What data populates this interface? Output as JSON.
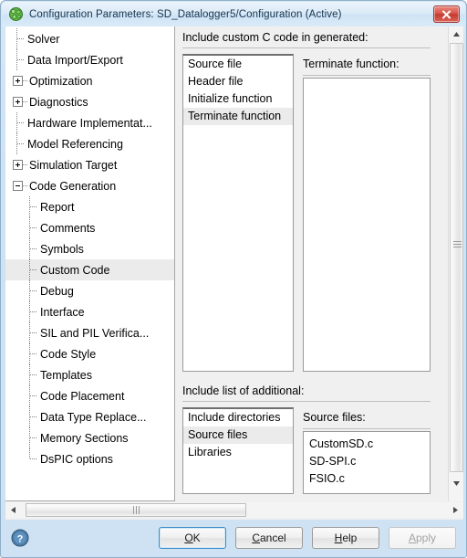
{
  "window": {
    "title": "Configuration Parameters: SD_Datalogger5/Configuration (Active)",
    "app_icon_name": "simulink-icon",
    "close_label": "x",
    "frame_color": "#cfe2f3",
    "titlebar_color": "#dcebf8",
    "close_button_color": "#c33a2f"
  },
  "sidebar": {
    "items": [
      {
        "label": "Solver",
        "depth": 1,
        "toggle": "none"
      },
      {
        "label": "Data Import/Export",
        "depth": 1,
        "toggle": "none"
      },
      {
        "label": "Optimization",
        "depth": 1,
        "toggle": "plus"
      },
      {
        "label": "Diagnostics",
        "depth": 1,
        "toggle": "plus"
      },
      {
        "label": "Hardware Implementat...",
        "depth": 1,
        "toggle": "none"
      },
      {
        "label": "Model Referencing",
        "depth": 1,
        "toggle": "none"
      },
      {
        "label": "Simulation Target",
        "depth": 1,
        "toggle": "plus"
      },
      {
        "label": "Code Generation",
        "depth": 1,
        "toggle": "minus"
      },
      {
        "label": "Report",
        "depth": 2,
        "toggle": "none"
      },
      {
        "label": "Comments",
        "depth": 2,
        "toggle": "none"
      },
      {
        "label": "Symbols",
        "depth": 2,
        "toggle": "none"
      },
      {
        "label": "Custom Code",
        "depth": 2,
        "toggle": "none",
        "selected": true
      },
      {
        "label": "Debug",
        "depth": 2,
        "toggle": "none"
      },
      {
        "label": "Interface",
        "depth": 2,
        "toggle": "none"
      },
      {
        "label": "SIL and PIL Verifica...",
        "depth": 2,
        "toggle": "none"
      },
      {
        "label": "Code Style",
        "depth": 2,
        "toggle": "none"
      },
      {
        "label": "Templates",
        "depth": 2,
        "toggle": "none"
      },
      {
        "label": "Code Placement",
        "depth": 2,
        "toggle": "none"
      },
      {
        "label": "Data Type Replace...",
        "depth": 2,
        "toggle": "none"
      },
      {
        "label": "Memory Sections",
        "depth": 2,
        "toggle": "none"
      },
      {
        "label": "DsPIC options",
        "depth": 2,
        "toggle": "none",
        "last": true
      }
    ],
    "selected_item": "Custom Code"
  },
  "main": {
    "custom_code": {
      "group_label": "Include custom C code in generated:",
      "list_items": [
        "Source file",
        "Header file",
        "Initialize function",
        "Terminate function"
      ],
      "selected_item": "Terminate function",
      "editor_label": "Terminate function:",
      "editor_value": ""
    },
    "additional": {
      "group_label": "Include list of additional:",
      "list_items": [
        "Include directories",
        "Source files",
        "Libraries"
      ],
      "selected_item": "Source files",
      "editor_label": "Source files:",
      "editor_lines": [
        "CustomSD.c",
        "SD-SPI.c",
        "FSIO.c"
      ]
    }
  },
  "scrollbars": {
    "vertical_up_arrow": "▲",
    "vertical_down_arrow": "▼",
    "horizontal_left_arrow": "◀",
    "horizontal_right_arrow": "▶"
  },
  "footer": {
    "help_icon_name": "help-circle-icon",
    "buttons": [
      {
        "label": "OK",
        "mnemonic": "O",
        "state": "focused"
      },
      {
        "label": "Cancel",
        "mnemonic": "C",
        "state": "normal"
      },
      {
        "label": "Help",
        "mnemonic": "H",
        "state": "normal"
      },
      {
        "label": "Apply",
        "mnemonic": "A",
        "state": "disabled"
      }
    ]
  }
}
